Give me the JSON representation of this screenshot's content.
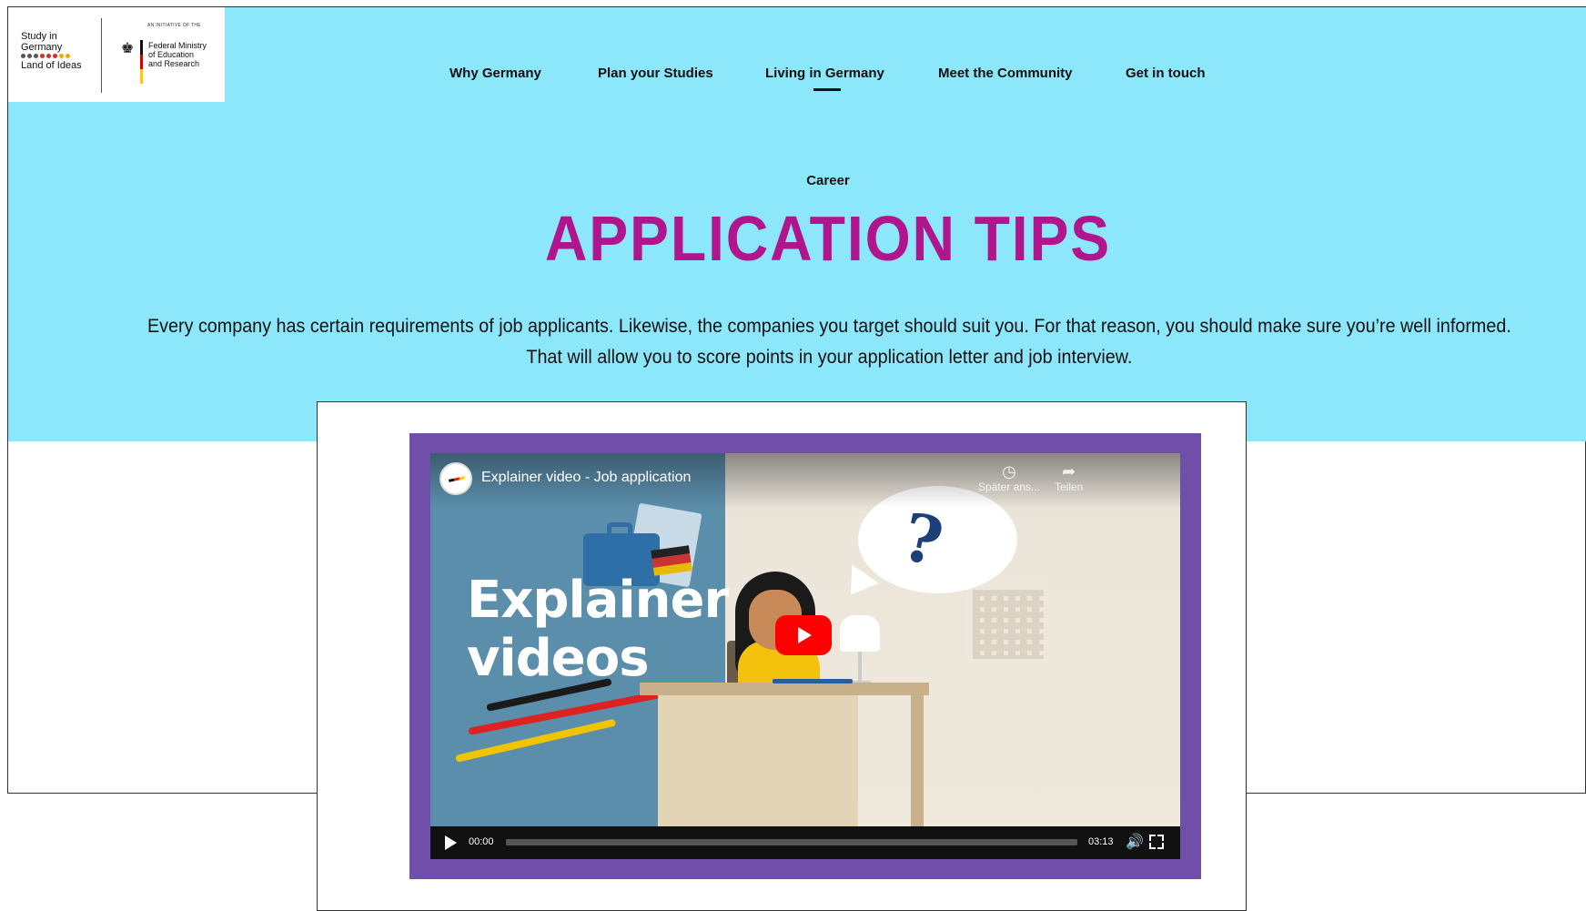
{
  "logo": {
    "line1": "Study in",
    "line2": "Germany",
    "line3": "Land of Ideas",
    "initiative": "AN INITIATIVE OF THE",
    "ministry_line1": "Federal Ministry",
    "ministry_line2": "of Education",
    "ministry_line3": "and Research",
    "dot_colors": [
      "#555555",
      "#555555",
      "#555555",
      "#d32f2f",
      "#d32f2f",
      "#d32f2f",
      "#f7a600",
      "#f7a600"
    ]
  },
  "nav": {
    "items": [
      {
        "label": "Why Germany"
      },
      {
        "label": "Plan your Studies"
      },
      {
        "label": "Living in Germany",
        "active": true
      },
      {
        "label": "Meet the Community"
      },
      {
        "label": "Get in touch"
      }
    ]
  },
  "hero": {
    "eyebrow": "Career",
    "title": "APPLICATION TIPS",
    "intro_line1": "Every company has certain requirements of job applicants. Likewise, the companies you target should suit you. For that reason, you should make sure you’re well informed.",
    "intro_line2": "That will allow you to score points in your application letter and job interview.",
    "background": "#8de7fb",
    "title_color": "#b0158e"
  },
  "video": {
    "title": "Explainer video - Job application",
    "thumbnail_text_line1": "Explainer",
    "thumbnail_text_line2": "videos",
    "watch_later_label": "Später ans...",
    "share_label": "Teilen",
    "time_current": "00:00",
    "time_total": "03:13",
    "progress": 0,
    "frame_color": "#6f4fa7"
  }
}
